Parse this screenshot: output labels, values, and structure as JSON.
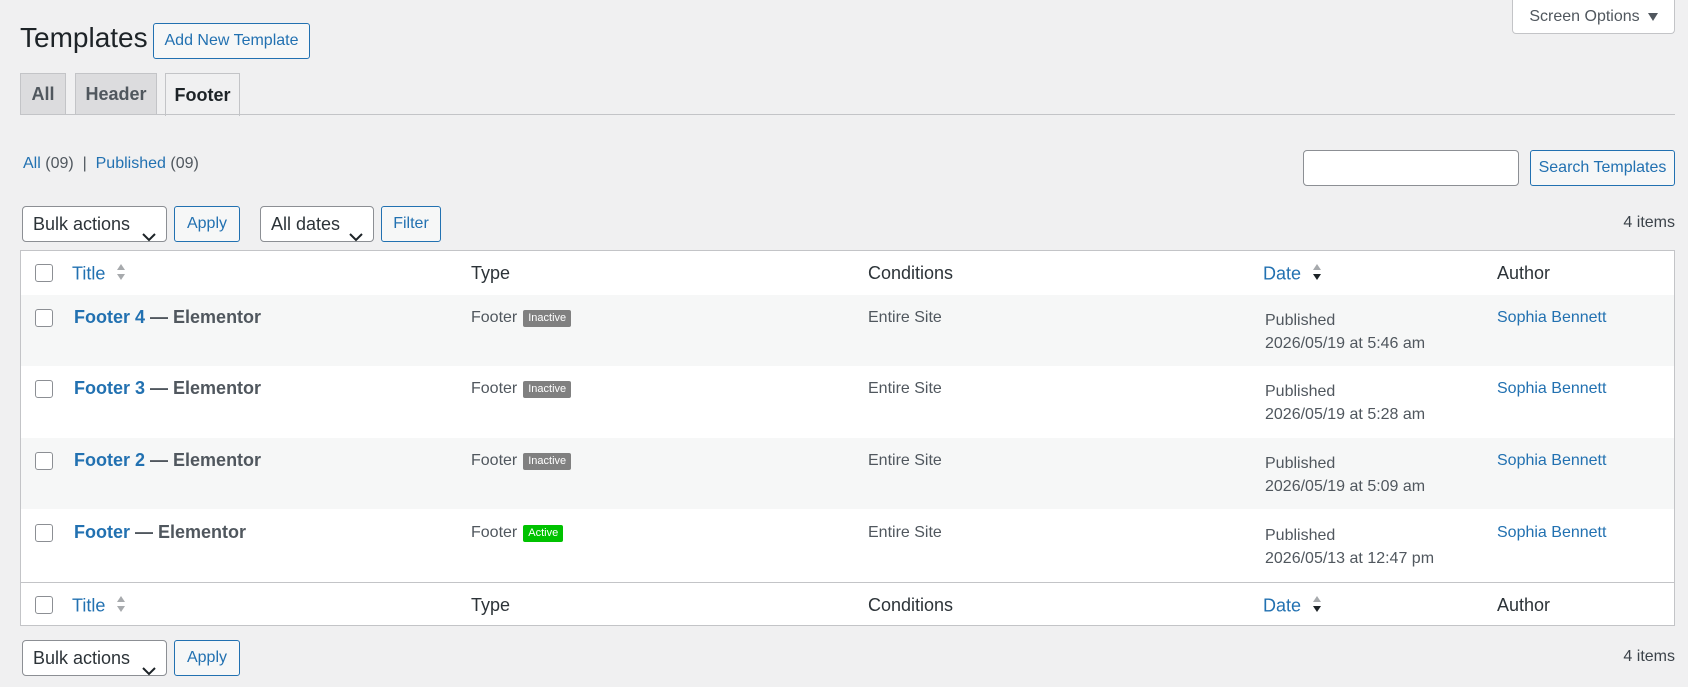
{
  "header": {
    "page_title": "Templates",
    "add_new_label": "Add New Template",
    "screen_options_label": "Screen Options"
  },
  "tabs": [
    {
      "label": "All"
    },
    {
      "label": "Header"
    },
    {
      "label": "Footer",
      "active": true
    }
  ],
  "views": {
    "all_label": "All",
    "all_count": "(09)",
    "separator": "|",
    "published_label": "Published",
    "published_count": "(09)"
  },
  "search": {
    "value": "",
    "button_label": "Search Templates"
  },
  "toolbar_top": {
    "bulk_actions": "Bulk actions",
    "apply_label": "Apply",
    "dates_filter": "All dates",
    "filter_label": "Filter",
    "items_count": "4 items"
  },
  "toolbar_bottom": {
    "bulk_actions": "Bulk actions",
    "apply_label": "Apply",
    "items_count": "4 items"
  },
  "table": {
    "columns": [
      "Title",
      "Type",
      "Conditions",
      "Date",
      "Author"
    ],
    "rows": [
      {
        "title_link": "Footer 4",
        "title_suffix": "— Elementor",
        "type": "Footer",
        "status": "Inactive",
        "conditions": "Entire Site",
        "date_status": "Published",
        "date": "2026/05/19 at 5:46 am",
        "author": "Sophia Bennett"
      },
      {
        "title_link": "Footer 3",
        "title_suffix": "— Elementor",
        "type": "Footer",
        "status": "Inactive",
        "conditions": "Entire Site",
        "date_status": "Published",
        "date": "2026/05/19 at 5:28 am",
        "author": "Sophia Bennett"
      },
      {
        "title_link": "Footer 2",
        "title_suffix": "— Elementor",
        "type": "Footer",
        "status": "Inactive",
        "conditions": "Entire Site",
        "date_status": "Published",
        "date": "2026/05/19 at 5:09 am",
        "author": "Sophia Bennett"
      },
      {
        "title_link": "Footer",
        "title_suffix": "— Elementor",
        "type": "Footer",
        "status": "Active",
        "conditions": "Entire Site",
        "date_status": "Published",
        "date": "2026/05/13 at 12:47 pm",
        "author": "Sophia Bennett"
      }
    ]
  },
  "colors": {
    "link": "#2271b1",
    "background": "#f0f0f1",
    "inactive_badge": "#808080",
    "active_badge": "#00c200"
  }
}
